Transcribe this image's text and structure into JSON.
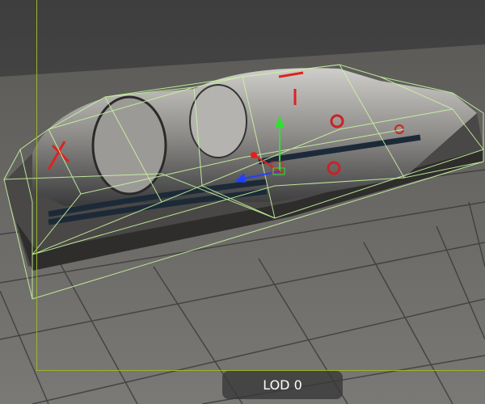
{
  "viewport": {
    "lod_label": "LOD 0",
    "frame_color": "#9bb52a",
    "wireframe_color": "#c8f5a0",
    "gizmo": {
      "x_color": "#e02020",
      "y_color": "#30e030",
      "z_color": "#2040ff"
    }
  }
}
